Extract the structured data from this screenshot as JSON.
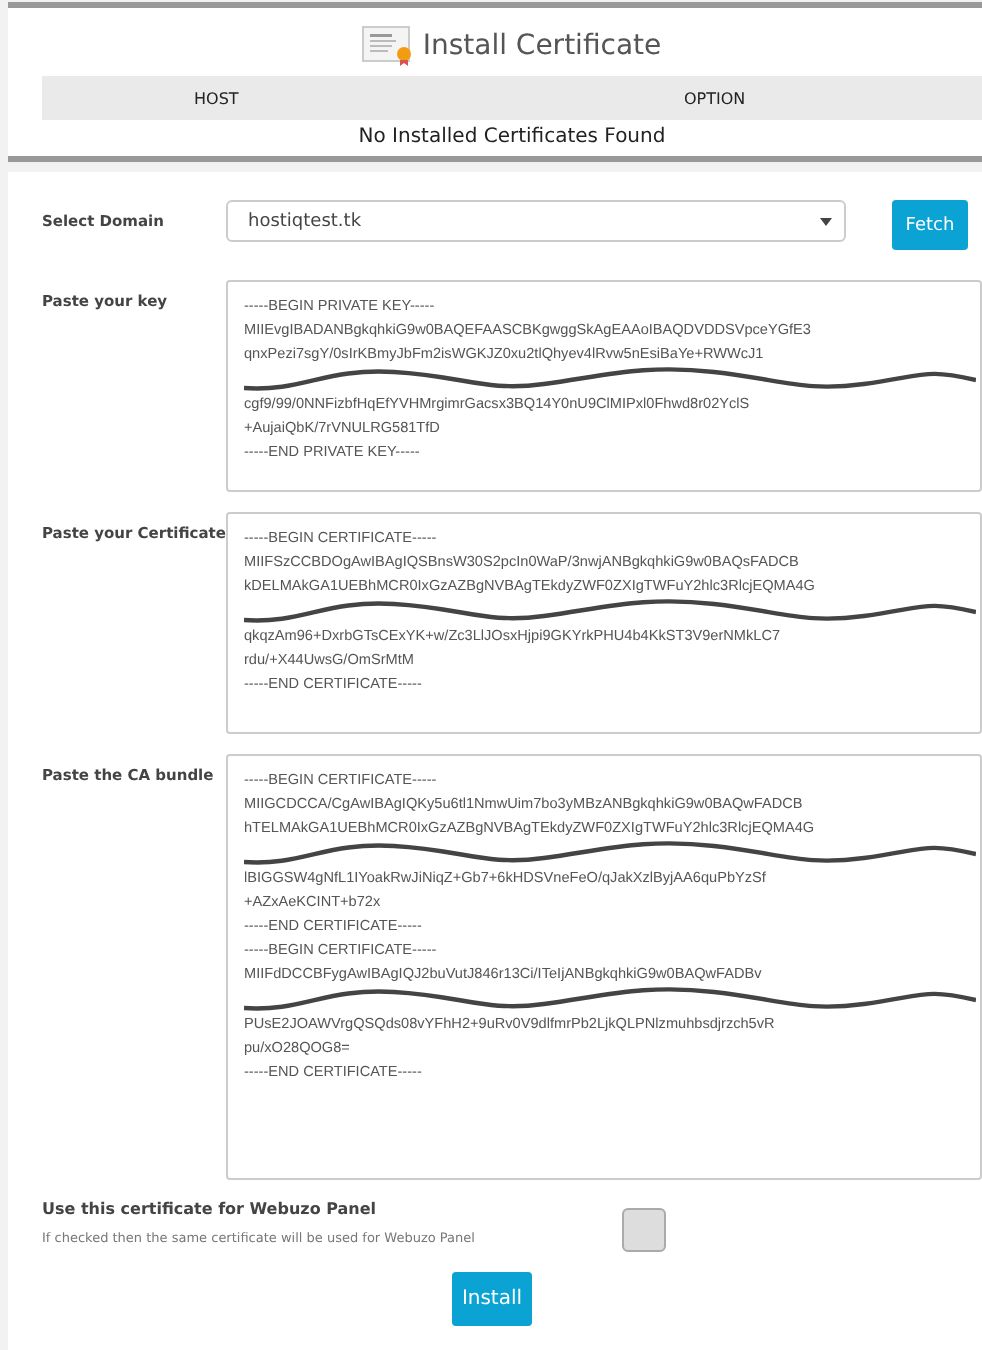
{
  "header": {
    "title": "Install Certificate",
    "columns": [
      "HOST",
      "OPTION"
    ],
    "empty_message": "No Installed Certificates Found"
  },
  "fields": [
    {
      "kind": "select",
      "label": "Select Domain",
      "value": "hostiqtest.tk",
      "button": "Fetch"
    },
    {
      "kind": "textarea",
      "label": "Paste your key",
      "segments": [
        {
          "kind": "text",
          "lines": [
            "-----BEGIN PRIVATE KEY-----",
            "MIIEvgIBADANBgkqhkiG9w0BAQEFAASCBKgwggSkAgEAAoIBAQDVDDSVpceYGfE3",
            "qnxPezi7sgY/0sIrKBmyJbFm2isWGKJZ0xu2tlQhyev4lRvw5nEsiBaYe+RWWcJ1"
          ]
        },
        {
          "kind": "scribble"
        },
        {
          "kind": "text",
          "lines": [
            "cgf9/99/0NNFizbfHqEfYVHMrgimrGacsx3BQ14Y0nU9ClMIPxl0Fhwd8r02YclS",
            "+AujaiQbK/7rVNULRG581TfD",
            "-----END PRIVATE KEY-----"
          ]
        }
      ]
    },
    {
      "kind": "textarea",
      "label": "Paste your Certificate",
      "segments": [
        {
          "kind": "text",
          "lines": [
            "-----BEGIN CERTIFICATE-----",
            "MIIFSzCCBDOgAwIBAgIQSBnsW30S2pcIn0WaP/3nwjANBgkqhkiG9w0BAQsFADCB",
            "kDELMAkGA1UEBhMCR0IxGzAZBgNVBAgTEkdyZWF0ZXIgTWFuY2hlc3RlcjEQMA4G"
          ]
        },
        {
          "kind": "scribble"
        },
        {
          "kind": "text",
          "lines": [
            "qkqzAm96+DxrbGTsCExYK+w/Zc3LlJOsxHjpi9GKYrkPHU4b4KkST3V9erNMkLC7",
            "rdu/+X44UwsG/OmSrMtM",
            "-----END CERTIFICATE-----"
          ]
        }
      ]
    },
    {
      "kind": "textarea",
      "label": "Paste the CA bundle",
      "segments": [
        {
          "kind": "text",
          "lines": [
            "-----BEGIN CERTIFICATE-----",
            "MIIGCDCCA/CgAwIBAgIQKy5u6tl1NmwUim7bo3yMBzANBgkqhkiG9w0BAQwFADCB",
            "hTELMAkGA1UEBhMCR0IxGzAZBgNVBAgTEkdyZWF0ZXIgTWFuY2hlc3RlcjEQMA4G"
          ]
        },
        {
          "kind": "scribble"
        },
        {
          "kind": "text",
          "lines": [
            "lBIGGSW4gNfL1IYoakRwJiNiqZ+Gb7+6kHDSVneFeO/qJakXzlByjAA6quPbYzSf",
            "+AZxAeKCINT+b72x",
            "-----END CERTIFICATE-----",
            "-----BEGIN CERTIFICATE-----",
            "MIIFdDCCBFygAwIBAgIQJ2buVutJ846r13Ci/ITeIjANBgkqhkiG9w0BAQwFADBv"
          ]
        },
        {
          "kind": "scribble"
        },
        {
          "kind": "text",
          "lines": [
            "PUsE2JOAWVrgQSQds08vYFhH2+9uRv0V9dlfmrPb2LjkQLPNlzmuhbsdjrzch5vR",
            "pu/xO28QOG8=",
            "-----END CERTIFICATE-----"
          ]
        }
      ]
    }
  ],
  "panel_option": {
    "label": "Use this certificate for Webuzo Panel",
    "hint": "If checked then the same certificate will be used for Webuzo Panel",
    "checked": false
  },
  "submit": "Install"
}
